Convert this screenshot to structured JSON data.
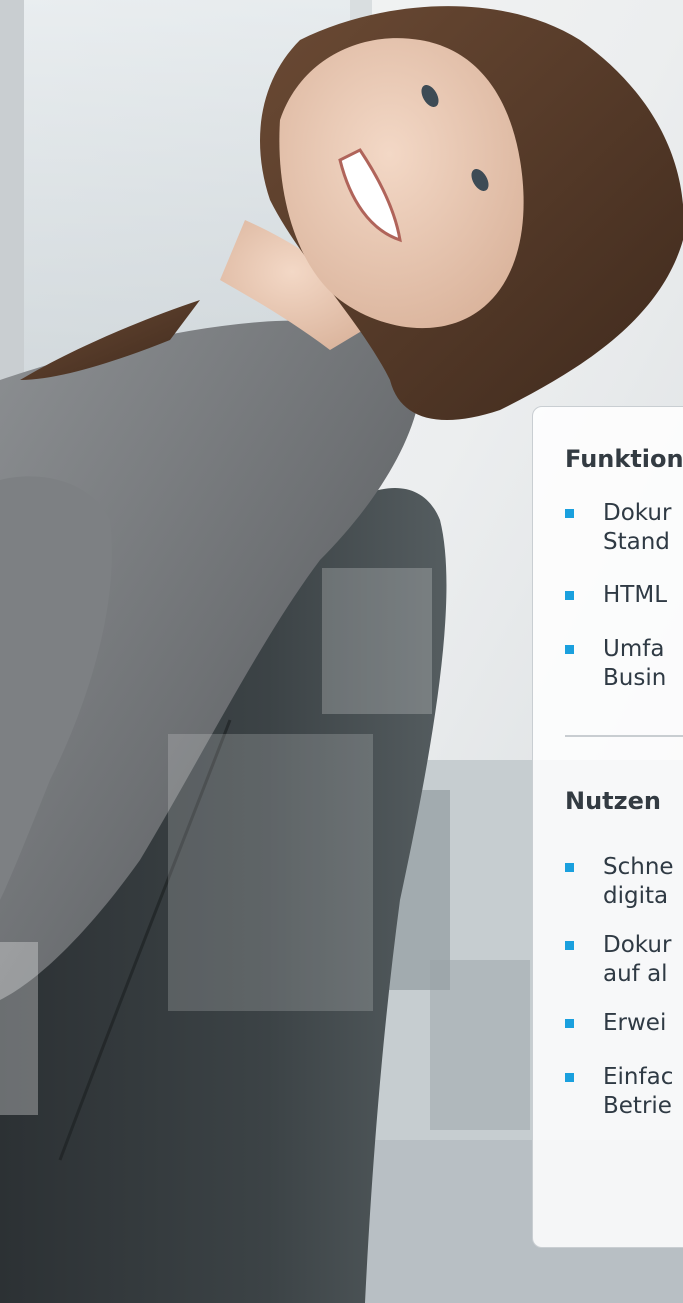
{
  "card": {
    "sections": [
      {
        "heading": "Funktion",
        "items": [
          {
            "line1": "Dokur",
            "line2": "Stand"
          },
          {
            "line1": "HTML",
            "line2": ""
          },
          {
            "line1": "Umfa",
            "line2": "Busin"
          }
        ]
      },
      {
        "heading": "Nutzen",
        "items": [
          {
            "line1": "Schne",
            "line2": "digita"
          },
          {
            "line1": "Dokur",
            "line2": "auf al"
          },
          {
            "line1": "Erwei",
            "line2": ""
          },
          {
            "line1": "Einfac",
            "line2": "Betrie"
          }
        ]
      }
    ]
  },
  "colors": {
    "bullet": "#1aa0de",
    "heading_text": "#333b42",
    "body_text": "#2f3a44",
    "card_border": "#c9ced2"
  },
  "image": {
    "icon": "photo-smiling-woman-office-chair"
  }
}
